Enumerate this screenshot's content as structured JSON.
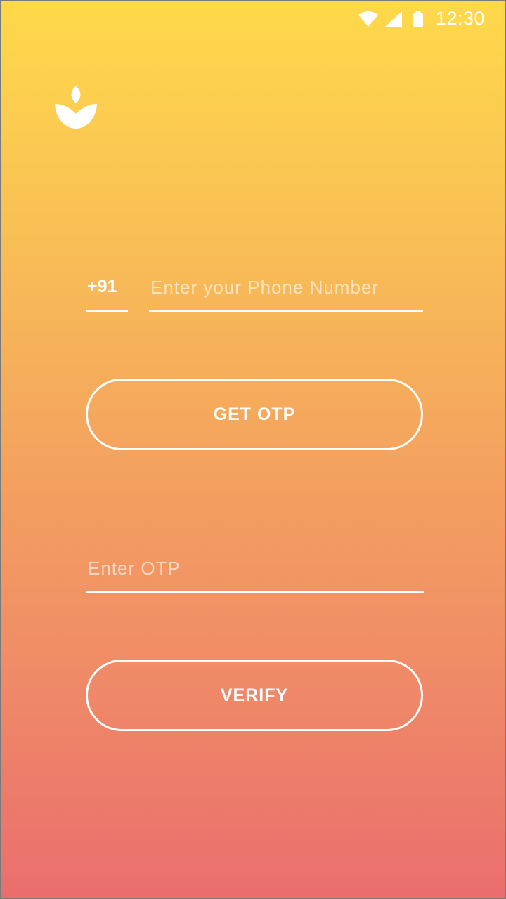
{
  "status_bar": {
    "time": "12:30",
    "icons": [
      "wifi-icon",
      "cellular-signal-icon",
      "battery-icon"
    ]
  },
  "logo": {
    "icon": "lotus-leaf-icon"
  },
  "phone": {
    "country_code": "+91",
    "placeholder": "Enter your Phone Number",
    "value": ""
  },
  "get_otp_button": {
    "label": "GET OTP"
  },
  "otp": {
    "placeholder": "Enter OTP",
    "value": ""
  },
  "verify_button": {
    "label": "VERIFY"
  },
  "colors": {
    "gradient_top": "#FFD94A",
    "gradient_bottom": "#EA6E6E",
    "foreground": "#FFFFFF"
  }
}
